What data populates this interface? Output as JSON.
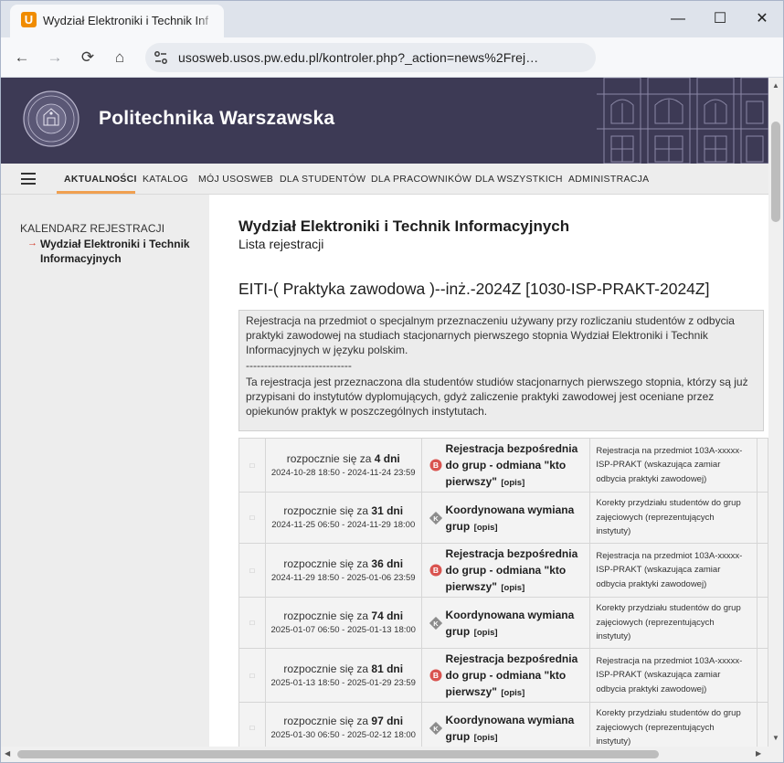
{
  "browser": {
    "tab_title": "Wydział Elektroniki i Technik Inf",
    "favicon_letter": "U",
    "favicon_color": "#f08c00",
    "url": "usosweb.usos.pw.edu.pl/kontroler.php?_action=news%2Frej…",
    "window_controls": {
      "minimize": "—",
      "maximize": "☐",
      "close": "✕"
    },
    "nav": {
      "back": "←",
      "forward": "→",
      "reload": "⟳",
      "home": "⌂"
    }
  },
  "banner": {
    "title": "Politechnika Warszawska",
    "bg_color": "#3d3a55"
  },
  "menu": {
    "items": [
      {
        "label": "AKTUALNOŚCI",
        "active": true
      },
      {
        "label": "KATALOG"
      },
      {
        "label": "MÓJ USOSWEB"
      },
      {
        "label": "DLA STUDENTÓW"
      },
      {
        "label": "DLA PRACOWNIKÓW"
      },
      {
        "label": "DLA WSZYSTKICH"
      },
      {
        "label": "ADMINISTRACJA"
      }
    ],
    "accent_color": "#f0a050"
  },
  "sidebar": {
    "heading": "KALENDARZ REJESTRACJI",
    "arrow": "→",
    "link": "Wydział Elektroniki i Technik Informacyjnych"
  },
  "main": {
    "faculty": "Wydział Elektroniki i Technik Informacyjnych",
    "subtitle": "Lista rejestracji",
    "registration_title": "EITI-( Praktyka zawodowa )--inż.-2024Z [1030-ISP-PRAKT-2024Z]",
    "description": {
      "p1": "Rejestracja na przedmiot o specjalnym przeznaczeniu używany przy rozliczaniu studentów z odbycia praktyki zawodowej na studiach stacjonarnych pierwszego stopnia Wydział Elektroniki i Technik Informacyjnych w języku polskim.",
      "separator": "-----------------------------",
      "p2": "Ta rejestracja jest przeznaczona dla studentów studiów stacjonarnych pierwszego stopnia, którzy są już przypisani do instytutów dyplomujących, gdyż zaliczenie praktyki zawodowej jest oceniane przez opiekunów praktyk w poszczególnych instytutach."
    },
    "rows": [
      {
        "check": "□",
        "prefix": "rozpocznie się za ",
        "days": "4 dni",
        "range": "2024-10-28 18:50 - 2024-11-24 23:59",
        "type_icon": "B",
        "type_name": "Rejestracja bezpośrednia do grup - odmiana \"kto pierwszy\"",
        "opis": "[opis]",
        "note": "Rejestracja na przedmiot 103A-xxxxx-ISP-PRAKT (wskazująca zamiar odbycia praktyki zawodowej)"
      },
      {
        "check": "□",
        "prefix": "rozpocznie się za ",
        "days": "31 dni",
        "range": "2024-11-25 06:50 - 2024-11-29 18:00",
        "type_icon": "K",
        "type_name": "Koordynowana wymiana grup",
        "opis": "[opis]",
        "note": "Korekty przydziału studentów do grup zajęciowych (reprezentujących instytuty)"
      },
      {
        "check": "□",
        "prefix": "rozpocznie się za ",
        "days": "36 dni",
        "range": "2024-11-29 18:50 - 2025-01-06 23:59",
        "type_icon": "B",
        "type_name": "Rejestracja bezpośrednia do grup - odmiana \"kto pierwszy\"",
        "opis": "[opis]",
        "note": "Rejestracja na przedmiot 103A-xxxxx-ISP-PRAKT (wskazująca zamiar odbycia praktyki zawodowej)"
      },
      {
        "check": "□",
        "prefix": "rozpocznie się za ",
        "days": "74 dni",
        "range": "2025-01-07 06:50 - 2025-01-13 18:00",
        "type_icon": "K",
        "type_name": "Koordynowana wymiana grup",
        "opis": "[opis]",
        "note": "Korekty przydziału studentów do grup zajęciowych (reprezentujących instytuty)"
      },
      {
        "check": "□",
        "prefix": "rozpocznie się za ",
        "days": "81 dni",
        "range": "2025-01-13 18:50 - 2025-01-29 23:59",
        "type_icon": "B",
        "type_name": "Rejestracja bezpośrednia do grup - odmiana \"kto pierwszy\"",
        "opis": "[opis]",
        "note": "Rejestracja na przedmiot 103A-xxxxx-ISP-PRAKT (wskazująca zamiar odbycia praktyki zawodowej)"
      },
      {
        "check": "□",
        "prefix": "rozpocznie się za ",
        "days": "97 dni",
        "range": "2025-01-30 06:50 - 2025-02-12 18:00",
        "type_icon": "K",
        "type_name": "Koordynowana wymiana grup",
        "opis": "[opis]",
        "note": "Korekty przydziału studentów do grup zajęciowych (reprezentujących instytuty)"
      }
    ]
  },
  "icon_colors": {
    "B": "#d9534f",
    "K": "#8c8c8c"
  }
}
